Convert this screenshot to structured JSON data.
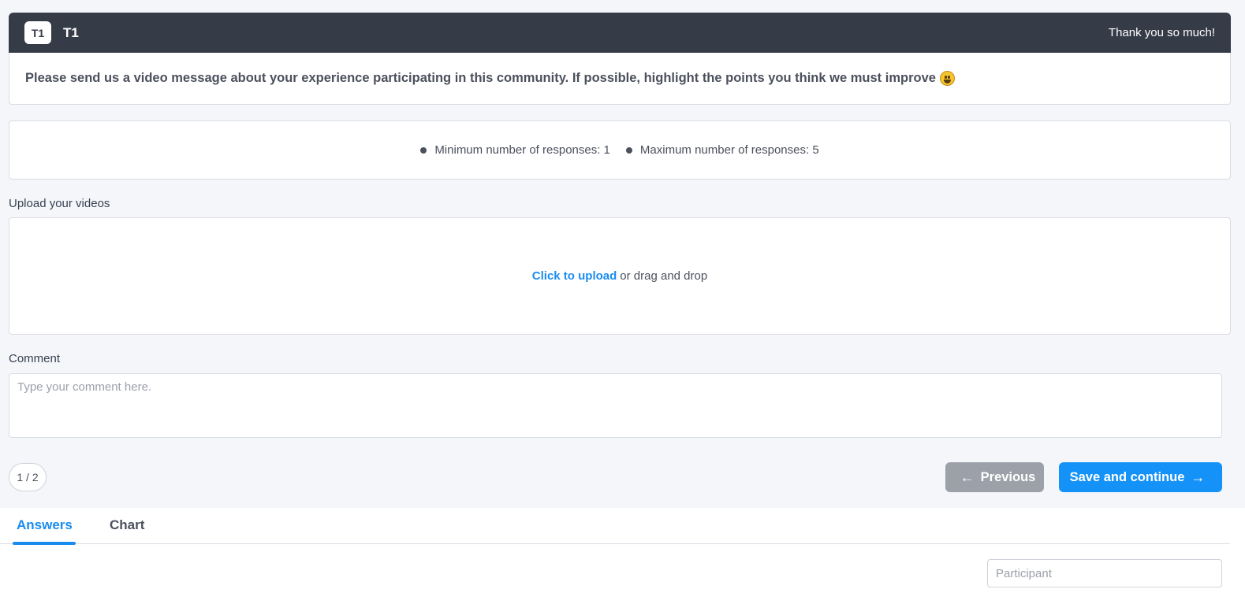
{
  "task": {
    "badge": "T1",
    "title": "T1",
    "thanks": "Thank you so much!",
    "question": "Please send us a video message about your experience participating in this community. If possible, highlight the points you think we must improve"
  },
  "limits": {
    "min": "Minimum number of responses: 1",
    "max": "Maximum number of responses: 5"
  },
  "upload": {
    "label": "Upload your videos",
    "link": "Click to upload",
    "hint": "or drag and drop"
  },
  "comment": {
    "label": "Comment",
    "placeholder": "Type your comment here."
  },
  "nav": {
    "pager": "1 / 2",
    "previous": "Previous",
    "save": "Save and continue"
  },
  "tabs": {
    "answers": "Answers",
    "chart": "Chart",
    "active": "Answers"
  },
  "filter": {
    "participant_placeholder": "Participant"
  },
  "colors": {
    "header": "#363b48",
    "accent": "#1592f7",
    "disabled": "#9ca0a8"
  }
}
